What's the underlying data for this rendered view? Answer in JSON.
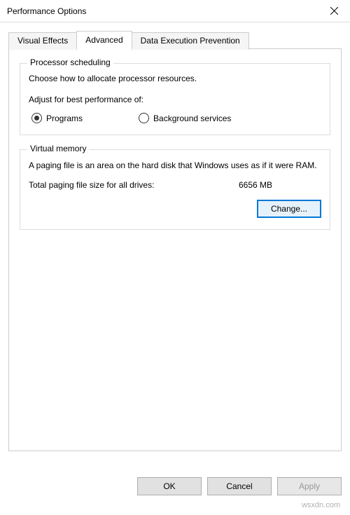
{
  "window": {
    "title": "Performance Options"
  },
  "tabs": {
    "visual_effects": "Visual Effects",
    "advanced": "Advanced",
    "dep": "Data Execution Prevention"
  },
  "processor_scheduling": {
    "legend": "Processor scheduling",
    "description": "Choose how to allocate processor resources.",
    "adjust_label": "Adjust for best performance of:",
    "programs": "Programs",
    "background_services": "Background services"
  },
  "virtual_memory": {
    "legend": "Virtual memory",
    "description": "A paging file is an area on the hard disk that Windows uses as if it were RAM.",
    "total_label": "Total paging file size for all drives:",
    "total_value": "6656 MB",
    "change_button": "Change..."
  },
  "buttons": {
    "ok": "OK",
    "cancel": "Cancel",
    "apply": "Apply"
  },
  "watermark": "wsxdn.com"
}
